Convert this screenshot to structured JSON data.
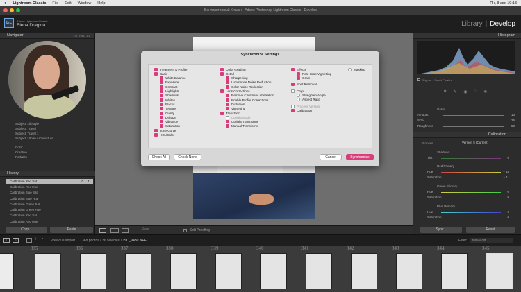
{
  "menubar": {
    "app": "Lightroom Classic",
    "items": [
      "File",
      "Edit",
      "Window",
      "Help"
    ],
    "clock": "Пн, 8 авг. 19:18"
  },
  "window": {
    "title": "Вентиляторный Клакзн - Adobe Photoshop Lightroom Classic - Develop"
  },
  "identity": {
    "logo": "Lrc",
    "product": "Adobe Lightroom Classic",
    "user": "Elena Dragina",
    "modules": [
      "Library",
      "Develop"
    ],
    "separator": "|"
  },
  "left": {
    "navigator": "Navigator",
    "nav_modes": [
      "FIT",
      "FILL",
      "1:1"
    ],
    "collections": [
      "Subject: Lifestyle",
      "Subject: Travel",
      "Subject: Travel 1",
      "Subject: Urban Architecture"
    ],
    "presets": [
      "Color",
      "Creative",
      "Portraits"
    ],
    "history": "History",
    "history_items": [
      {
        "label": "Calibration Red Sat",
        "a": "0",
        "b": "11"
      },
      {
        "label": "Calibration Red Hue",
        "a": "",
        "b": ""
      },
      {
        "label": "Calibration Blue Sat",
        "a": "",
        "b": ""
      },
      {
        "label": "Calibration Blue Hue",
        "a": "",
        "b": ""
      },
      {
        "label": "Calibration Green Sat",
        "a": "",
        "b": ""
      },
      {
        "label": "Calibration Green Hue",
        "a": "",
        "b": ""
      },
      {
        "label": "Calibration Red Sat",
        "a": "",
        "b": ""
      },
      {
        "label": "Calibration Red Hue",
        "a": "",
        "b": ""
      }
    ],
    "copy": "Copy...",
    "paste": "Paste"
  },
  "toolbar": {
    "zoom_label": "Zoom",
    "soft_proofing": "Soft Proofing"
  },
  "right": {
    "histogram": "Histogram",
    "original_label": "Original + Smart Preview",
    "grain": "Grain",
    "grain_items": [
      {
        "label": "Amount",
        "value": "13"
      },
      {
        "label": "Size",
        "value": "25"
      },
      {
        "label": "Roughness",
        "value": "50"
      }
    ],
    "calibration": "Calibration",
    "process_label": "Process",
    "process": "Version 5 (Current)",
    "shadows": "Shadows",
    "tint": "Tint",
    "tint_value": "0",
    "red_primary": "Red Primary",
    "green_primary": "Green Primary",
    "blue_primary": "Blue Primary",
    "hue": "Hue",
    "saturation": "Saturation",
    "red_hue": "+ 18",
    "red_sat": "+ 11",
    "green_hue": "0",
    "green_sat": "0",
    "blue_hue": "0",
    "blue_sat": "0",
    "sync": "Sync...",
    "reset": "Reset"
  },
  "filmbar": {
    "previous": "Previous Import",
    "count": "368 photos / 36 selected /",
    "file": "DSC_9430.NEF",
    "filter": "Filter:",
    "filters_off": "Filters Off"
  },
  "filmstrip": {
    "numbers": [
      "335",
      "336",
      "337",
      "338",
      "339",
      "340",
      "341",
      "342",
      "343",
      "344",
      "345",
      "346"
    ]
  },
  "dialog": {
    "title": "Synchronize Settings",
    "col1": [
      {
        "label": "Treatment & Profile",
        "on": true,
        "indent": 0
      },
      {
        "label": "Basic",
        "on": true,
        "indent": 0
      },
      {
        "label": "White Balance",
        "on": true,
        "indent": 1
      },
      {
        "label": "Exposure",
        "on": true,
        "indent": 1
      },
      {
        "label": "Contrast",
        "on": true,
        "indent": 1
      },
      {
        "label": "Highlights",
        "on": true,
        "indent": 1
      },
      {
        "label": "Shadows",
        "on": true,
        "indent": 1
      },
      {
        "label": "Whites",
        "on": true,
        "indent": 1
      },
      {
        "label": "Blacks",
        "on": true,
        "indent": 1
      },
      {
        "label": "Texture",
        "on": true,
        "indent": 1
      },
      {
        "label": "Clarity",
        "on": true,
        "indent": 1
      },
      {
        "label": "Dehaze",
        "on": true,
        "indent": 1
      },
      {
        "label": "Vibrance",
        "on": true,
        "indent": 1
      },
      {
        "label": "Saturation",
        "on": true,
        "indent": 1
      },
      {
        "label": "Tone Curve",
        "on": true,
        "indent": 0
      },
      {
        "label": "HSL/Color",
        "on": true,
        "indent": 0
      }
    ],
    "col2": [
      {
        "label": "Color Grading",
        "on": true,
        "indent": 0
      },
      {
        "label": "Detail",
        "on": true,
        "indent": 0
      },
      {
        "label": "Sharpening",
        "on": true,
        "indent": 1
      },
      {
        "label": "Luminance Noise Reduction",
        "on": true,
        "indent": 1
      },
      {
        "label": "Color Noise Reduction",
        "on": true,
        "indent": 1
      },
      {
        "label": "Lens Corrections",
        "on": true,
        "indent": 0
      },
      {
        "label": "Remove Chromatic Aberration",
        "on": true,
        "indent": 1
      },
      {
        "label": "Enable Profile Corrections",
        "on": true,
        "indent": 1
      },
      {
        "label": "Distortion",
        "on": true,
        "indent": 1
      },
      {
        "label": "Vignetting",
        "on": true,
        "indent": 1
      },
      {
        "label": "Transform",
        "on": true,
        "indent": 0
      },
      {
        "label": "Upright Mode",
        "on": false,
        "indent": 1,
        "disabled": true
      },
      {
        "label": "Upright Transforms",
        "on": true,
        "indent": 1
      },
      {
        "label": "Manual Transforms",
        "on": true,
        "indent": 1
      }
    ],
    "col3": [
      {
        "label": "Effects",
        "on": true,
        "indent": 0
      },
      {
        "label": "Post-Crop Vignetting",
        "on": true,
        "indent": 1
      },
      {
        "label": "Grain",
        "on": true,
        "indent": 1
      },
      {
        "label": "Spot Removal",
        "on": true,
        "indent": 0,
        "gap": true
      },
      {
        "label": "Crop",
        "on": false,
        "indent": 0,
        "gap": true
      },
      {
        "label": "Straighten Angle",
        "on": false,
        "indent": 1,
        "radio": true
      },
      {
        "label": "Aspect Ratio",
        "on": false,
        "indent": 1,
        "radio": true
      },
      {
        "label": "Process Version",
        "on": false,
        "indent": 0,
        "disabled": true,
        "gap": true
      },
      {
        "label": "Calibration",
        "on": true,
        "indent": 0
      }
    ],
    "col4": [
      {
        "label": "Masking",
        "on": false,
        "indent": 0,
        "radio": true
      }
    ],
    "check_all": "Check All",
    "check_none": "Check None",
    "cancel": "Cancel",
    "synchronize": "Synchronize"
  },
  "colors": {
    "accent": "#d93c7a",
    "panel": "#2c2c2c",
    "dialog": "#d7d7d7"
  }
}
